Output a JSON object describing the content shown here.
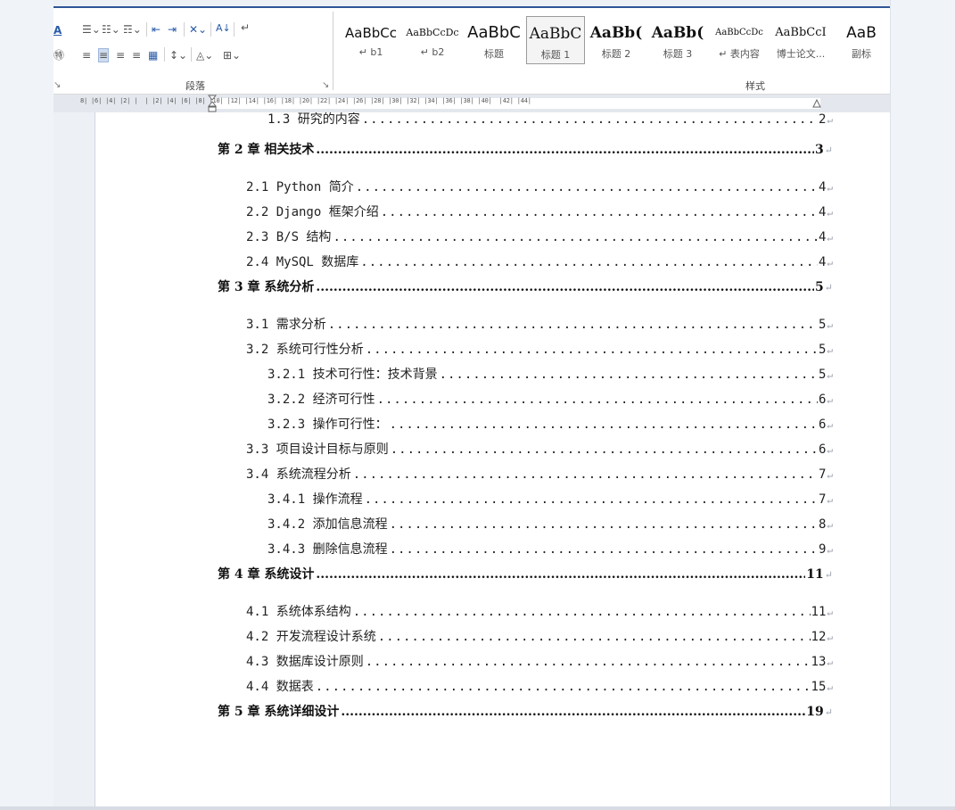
{
  "ribbon": {
    "paragraph_group_label": "段落",
    "styles_group_label": "样式",
    "styles": [
      {
        "preview": "AaBbCc",
        "label": "↵ b1",
        "selected": false
      },
      {
        "preview": "AaBbCcDc",
        "label": "↵ b2",
        "selected": false
      },
      {
        "preview": "AaBbC",
        "label": "标题",
        "selected": false
      },
      {
        "preview": "AaBbC",
        "label": "标题 1",
        "selected": true
      },
      {
        "preview": "AaBb(",
        "label": "标题 2",
        "selected": false
      },
      {
        "preview": "AaBb(",
        "label": "标题 3",
        "selected": false
      },
      {
        "preview": "AaBbCcDc",
        "label": "↵ 表内容",
        "selected": false
      },
      {
        "preview": "AaBbCcI",
        "label": "博士论文...",
        "selected": false
      },
      {
        "preview": "AaB",
        "label": "副标",
        "selected": false
      }
    ]
  },
  "ruler": {
    "numbers": "8| |6| |4| |2| |  | |2| |4| |6| |8| |10| |12| |14| |16| |18| |20| |22| |24| |26| |28| |30| |32| |34| |36| |38| |40|  |42| |44|"
  },
  "toc": [
    {
      "text": "1.3 研究的内容",
      "page": "2",
      "level": 3
    },
    {
      "text": "第 2 章 相关技术",
      "page": "3",
      "level": 1
    },
    {
      "text": "2.1 Python 简介",
      "page": "4",
      "level": 2
    },
    {
      "text": "2.2 Django 框架介绍",
      "page": "4",
      "level": 2
    },
    {
      "text": "2.3 B/S 结构",
      "page": "4",
      "level": 2
    },
    {
      "text": "2.4 MySQL 数据库",
      "page": "4",
      "level": 2
    },
    {
      "text": "第 3 章 系统分析",
      "page": "5",
      "level": 1
    },
    {
      "text": "3.1 需求分析",
      "page": "5",
      "level": 2
    },
    {
      "text": "3.2 系统可行性分析",
      "page": "5",
      "level": 2
    },
    {
      "text": "3.2.1 技术可行性：技术背景",
      "page": "5",
      "level": 3
    },
    {
      "text": "3.2.2 经济可行性",
      "page": "6",
      "level": 3
    },
    {
      "text": "3.2.3 操作可行性：",
      "page": "6",
      "level": 3
    },
    {
      "text": "3.3 项目设计目标与原则",
      "page": "6",
      "level": 2
    },
    {
      "text": "3.4 系统流程分析",
      "page": "7",
      "level": 2
    },
    {
      "text": "3.4.1 操作流程",
      "page": "7",
      "level": 3
    },
    {
      "text": "3.4.2 添加信息流程",
      "page": "8",
      "level": 3
    },
    {
      "text": "3.4.3 删除信息流程",
      "page": "9",
      "level": 3
    },
    {
      "text": "第 4 章 系统设计",
      "page": "11",
      "level": 1
    },
    {
      "text": "4.1 系统体系结构",
      "page": "11",
      "level": 2
    },
    {
      "text": "4.2 开发流程设计系统",
      "page": "12",
      "level": 2
    },
    {
      "text": "4.3 数据库设计原则",
      "page": "13",
      "level": 2
    },
    {
      "text": "4.4 数据表",
      "page": "15",
      "level": 2
    },
    {
      "text": "第 5 章 系统详细设计",
      "page": "19",
      "level": 1
    }
  ],
  "paragraph_mark": "↵",
  "leader": "............................................................................................................................................"
}
